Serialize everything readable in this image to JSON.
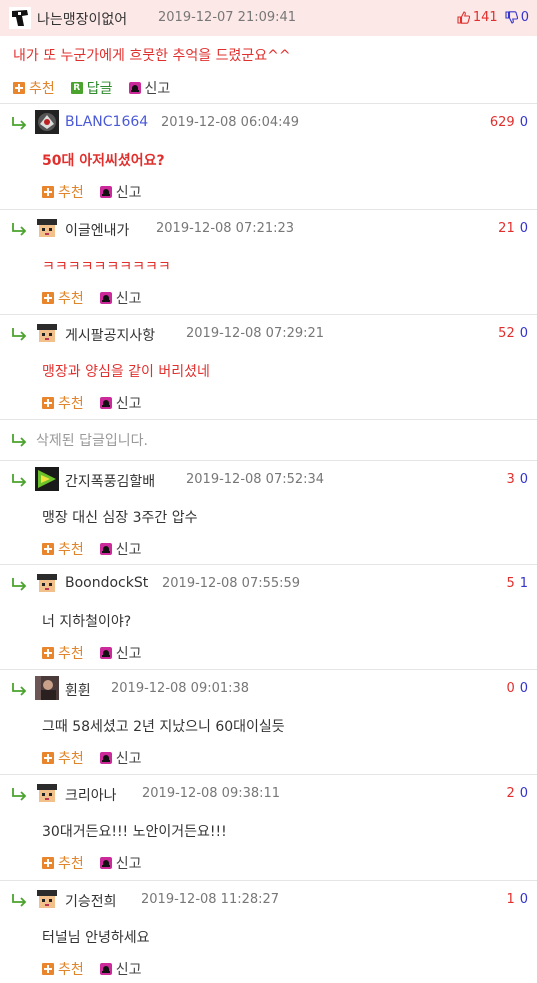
{
  "post": {
    "author": "나는맹장이없어",
    "date": "2019-12-07 21:09:41",
    "upvotes": "141",
    "downvotes": "0",
    "text": "내가 또 누군가에게 흐뭇한 추억을 드렸군요^^",
    "recommend_label": "추천",
    "reply_label": "답글",
    "reply_icon_letter": "R",
    "report_label": "신고"
  },
  "comments": [
    {
      "author": "BLANC1664",
      "date": "2019-12-08 06:04:49",
      "up": "629",
      "down": "0",
      "text": "50대 아저씨셨어요?",
      "avatar": "dark-badge"
    },
    {
      "author": "이글엔내가",
      "date": "2019-12-08 07:21:23",
      "up": "21",
      "down": "0",
      "text": "ㅋㅋㅋㅋㅋㅋㅋㅋㅋㅋ",
      "avatar": "pixel-face"
    },
    {
      "author": "게시팔공지사항",
      "date": "2019-12-08 07:29:21",
      "up": "52",
      "down": "0",
      "text": "맹장과 양심을 같이 버리셨네",
      "avatar": "pixel-face"
    },
    {
      "deleted_text": "삭제된 답글입니다."
    },
    {
      "author": "간지폭풍김할배",
      "date": "2019-12-08 07:52:34",
      "up": "3",
      "down": "0",
      "text": "맹장 대신 심장 3주간 압수",
      "avatar": "green-play"
    },
    {
      "author": "BoondockSt",
      "date": "2019-12-08 07:55:59",
      "up": "5",
      "down": "1",
      "text": "너 지하철이야?",
      "avatar": "pixel-face"
    },
    {
      "author": "휜휜",
      "date": "2019-12-08 09:01:38",
      "up": "0",
      "down": "0",
      "text": "그때 58세셨고 2년 지났으니 60대이실듯",
      "avatar": "photo"
    },
    {
      "author": "크리아나",
      "date": "2019-12-08 09:38:11",
      "up": "2",
      "down": "0",
      "text": "30대거든요!!! 노안이거든요!!!",
      "avatar": "pixel-face"
    },
    {
      "author": "기승전희",
      "date": "2019-12-08 11:28:27",
      "up": "1",
      "down": "0",
      "text": "터널님 안녕하세요",
      "avatar": "pixel-face"
    }
  ],
  "actions": {
    "recommend": "추천",
    "report": "신고"
  },
  "colors": {
    "accent_red": "#e0302e",
    "down_blue": "#3434cc",
    "post_bg": "#fde8e8",
    "reply_green": "#4aa32d",
    "recommend_orange": "#e8852d",
    "report_magenta": "#cc2a9b"
  }
}
